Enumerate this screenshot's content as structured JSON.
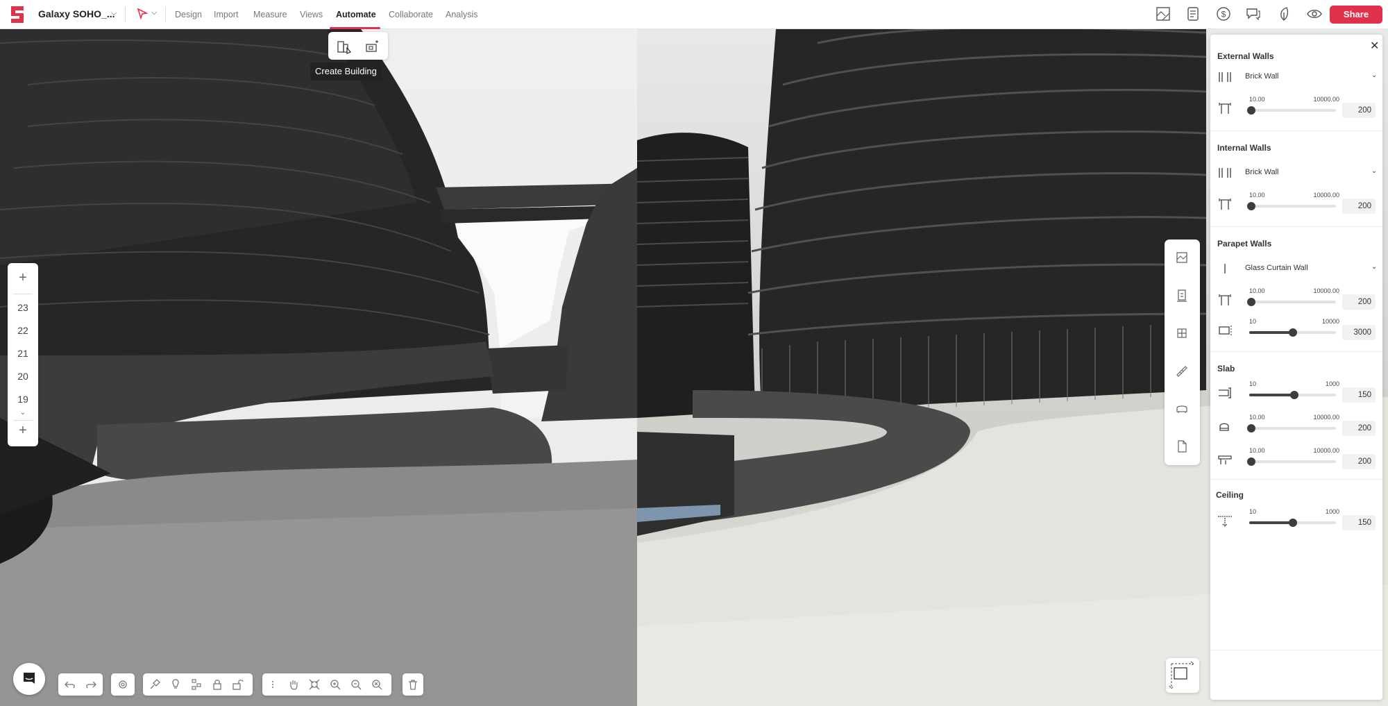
{
  "app": {
    "project_name": "Galaxy SOHO_...",
    "menu": [
      "Design",
      "Import",
      "Measure",
      "Views",
      "Automate",
      "Collaborate",
      "Analysis"
    ],
    "active_menu": "Automate",
    "share_label": "Share",
    "accent_color": "#e0314b",
    "right_icons": [
      "site-plan-icon",
      "schedule-icon",
      "cost-icon",
      "comments-icon",
      "sustainability-icon",
      "view-eye-icon"
    ]
  },
  "automate_popup": {
    "items": [
      "create-building-icon",
      "generate-building-icon"
    ],
    "tooltip": "Create Building"
  },
  "floors": {
    "levels": [
      "23",
      "22",
      "21",
      "20",
      "19"
    ]
  },
  "bottom_toolbar": {
    "groups": [
      [
        "undo-icon",
        "redo-icon"
      ],
      [
        "settings-icon"
      ],
      [
        "paint-icon",
        "light-icon",
        "hierarchy-icon",
        "lock-icon",
        "unlock-icon"
      ],
      [
        "more-icon",
        "pan-icon",
        "fit-icon",
        "zoom-in-icon",
        "zoom-out-icon",
        "zoom-extents-icon"
      ],
      [
        "delete-icon"
      ]
    ]
  },
  "side_tools": [
    "image-icon",
    "elevator-icon",
    "grid-icon",
    "measure-tape-icon",
    "furniture-icon",
    "document-icon"
  ],
  "panel": {
    "external_walls": {
      "title": "External Walls",
      "type": "Brick Wall",
      "thickness": {
        "min": "10.00",
        "max": "10000.00",
        "value": "200",
        "fraction": 0.02
      }
    },
    "internal_walls": {
      "title": "Internal Walls",
      "type": "Brick Wall",
      "thickness": {
        "min": "10.00",
        "max": "10000.00",
        "value": "200",
        "fraction": 0.02
      }
    },
    "parapet_walls": {
      "title": "Parapet Walls",
      "type": "Glass Curtain Wall",
      "thickness": {
        "min": "10.00",
        "max": "10000.00",
        "value": "200",
        "fraction": 0.02
      },
      "height": {
        "min": "10",
        "max": "10000",
        "value": "3000",
        "fraction": 0.5
      }
    },
    "slab": {
      "title": "Slab",
      "depth": {
        "min": "10",
        "max": "1000",
        "value": "150",
        "fraction": 0.52
      },
      "offset_a": {
        "min": "10.00",
        "max": "10000.00",
        "value": "200",
        "fraction": 0.02
      },
      "offset_b": {
        "min": "10.00",
        "max": "10000.00",
        "value": "200",
        "fraction": 0.02
      }
    },
    "ceiling": {
      "title": "Ceiling",
      "height": {
        "min": "10",
        "max": "1000",
        "value": "150",
        "fraction": 0.5
      }
    }
  }
}
